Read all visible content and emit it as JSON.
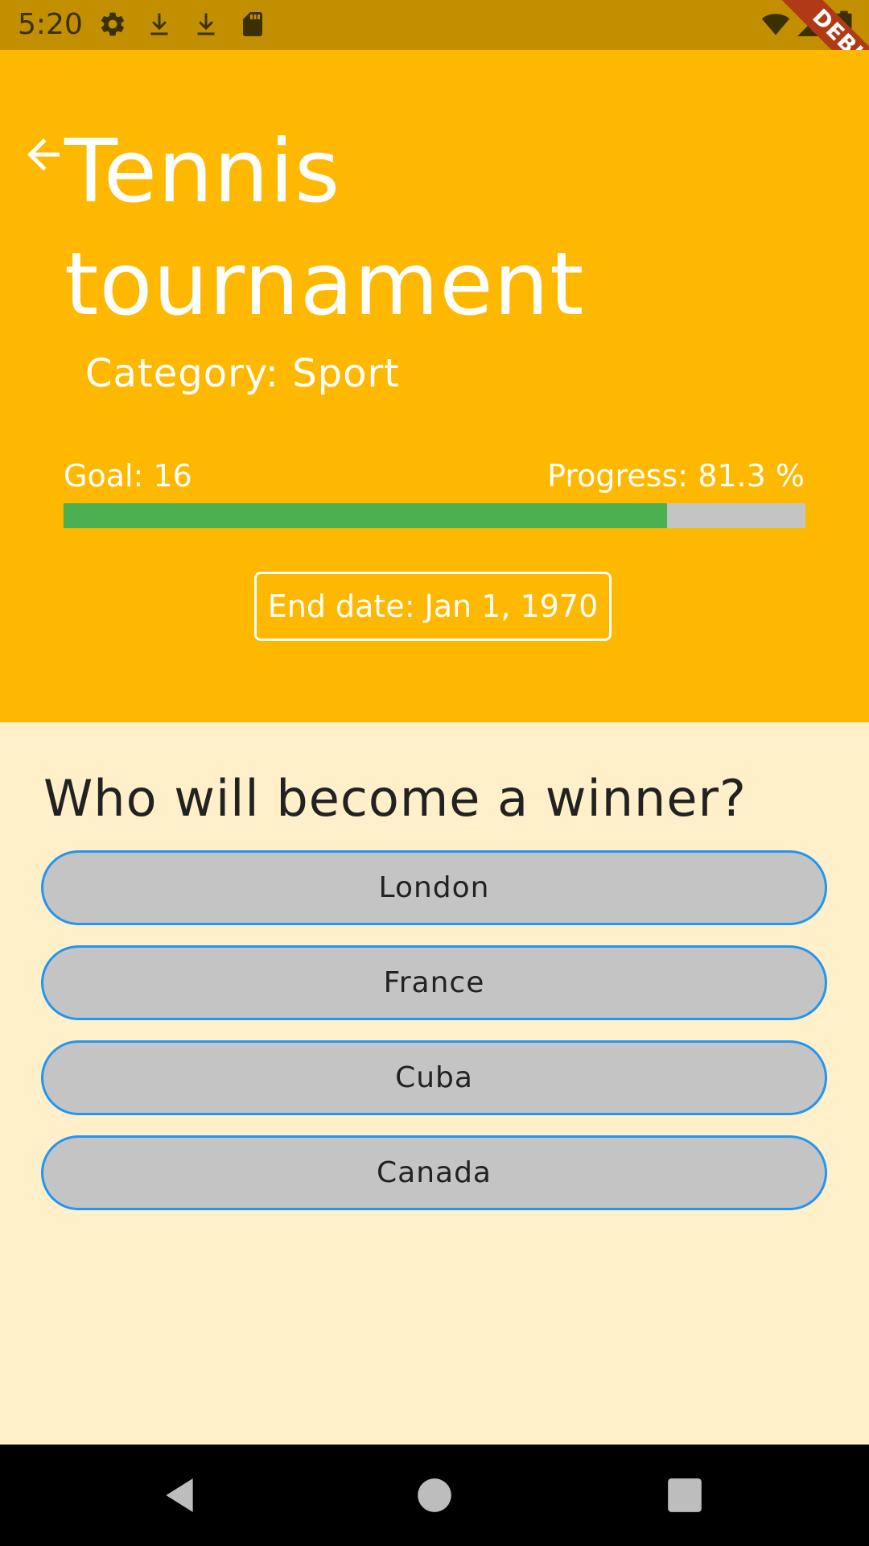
{
  "status_bar": {
    "time": "5:20",
    "icons": [
      "gear-icon",
      "download-icon",
      "download-icon",
      "sd-card-icon",
      "wifi-icon",
      "signal-icon",
      "battery-icon"
    ],
    "background": "#C28F00"
  },
  "debug_banner": {
    "label": "DEBUG",
    "color": "#B03A16"
  },
  "header": {
    "background": "#FFB800",
    "back_icon": "arrow-left-icon",
    "title": "Tennis tournament",
    "category": "Category: Sport",
    "goal": "Goal: 16",
    "progress_label": "Progress: 81.3 %",
    "progress_fraction": 0.813,
    "progress_color": "#4CAF50",
    "end_date": "End date: Jan 1, 1970"
  },
  "quiz": {
    "question": "Who will become a winner?",
    "answers": [
      {
        "label": "London"
      },
      {
        "label": "France"
      },
      {
        "label": "Cuba"
      },
      {
        "label": "Canada"
      }
    ],
    "answer_border_color": "#2196F3"
  },
  "nav_bar": {
    "buttons": [
      "back-triangle-icon",
      "home-circle-icon",
      "recents-square-icon"
    ]
  }
}
